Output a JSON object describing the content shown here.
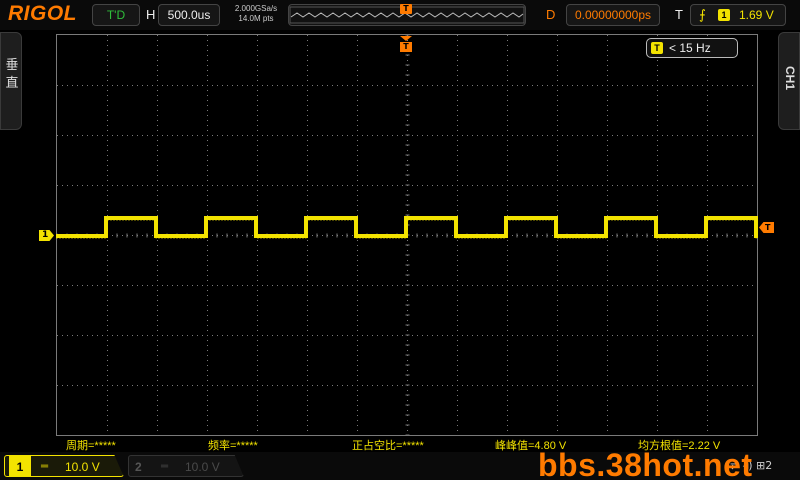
{
  "topbar": {
    "brand": "RIGOL",
    "run_state": "T'D",
    "timebase_label": "H",
    "timebase_value": "500.0us",
    "sample_rate": "2.000GSa/s",
    "memory_depth": "14.0M pts",
    "memory_marker": "T",
    "delay_label": "D",
    "delay_value": "0.00000000ps",
    "trigger_label": "T",
    "trigger_edge_icon": "rising-edge-icon",
    "trigger_source": "1",
    "trigger_level": "1.69 V"
  },
  "side_tabs": {
    "left": "垂直",
    "right": "CH1"
  },
  "freq_counter": {
    "tag": "T",
    "value": "< 15 Hz"
  },
  "markers": {
    "channel": "1",
    "trigger_level": "T",
    "trigger_position": "T"
  },
  "waveform": {
    "channel": 1,
    "color": "#f3e300",
    "shape": "square",
    "periods_visible": 7
  },
  "measurements": [
    {
      "label": "周期=*****"
    },
    {
      "label": "频率=*****"
    },
    {
      "label": "正占空比=*****"
    },
    {
      "label": "峰峰值=4.80 V"
    },
    {
      "label": "均方根值=2.22 V"
    }
  ],
  "bottombar": {
    "ch1": {
      "num": "1",
      "coupling": "═",
      "scale": "10.0 V"
    },
    "ch2": {
      "num": "2",
      "coupling": "═",
      "scale": "10.0 V"
    },
    "watermark": "bbs.38hot.net",
    "tray": "⇄ ◂) ⊞2"
  },
  "colors": {
    "accent": "#ff7b00",
    "ch1": "#f3e300",
    "grid": "#7a7a7a"
  }
}
